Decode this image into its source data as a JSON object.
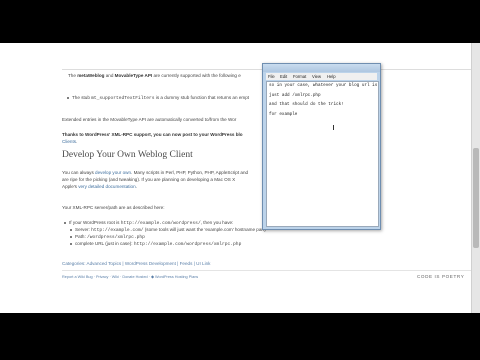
{
  "article": {
    "p1_a": "The ",
    "p1_api1": "metaWeblog",
    "p1_and": " and ",
    "p1_api2": "MovableType API",
    "p1_b": " are currently supported with the following e",
    "bullet1_a": "The stub ",
    "bullet1_code": "mt_supportedTextFilters",
    "bullet1_b": " is a dummy stub function that returns an empt",
    "p2": "Extended entries in the MovableType API are automatically converted to/from the Wor",
    "p3_bold": "Thanks to WordPress' XML-RPC support, you can now post to your WordPress blo",
    "p3_link": "Clients",
    "p3_tail": ".",
    "heading": "Develop Your Own Weblog Client",
    "p4_a": "You can always ",
    "p4_link": "develop your own",
    "p4_b": ". Many scripts in Perl, PHP, Python, PHP, AppleScript and",
    "p4_line2": "are ripe for the picking (and tweaking). If you are planning on developing a Mac OS X",
    "p4_line3_a": "Apple's ",
    "p4_line3_link": "very detailed documentation",
    "p4_line3_b": ".",
    "p5": "Your XML-RPC server/path are as described here:",
    "list_intro_a": "If your WordPress root is ",
    "list_intro_code": "http://example.com/wordpress/",
    "list_intro_b": ", then you have:",
    "sub1_a": "Server: ",
    "sub1_code": "http://example.com/",
    "sub1_b": " (some tools will just want the 'example.com' hostname part)",
    "sub2_a": "Path: ",
    "sub2_code": "/wordpress/xmlrpc.php",
    "sub3_a": "complete URL (just in case): ",
    "sub3_code": "http://example.com/wordpress/xmlrpc.php",
    "categories": "Categories: Advanced Topics | WordPress Development | Feeds | UI Link",
    "footer_links": "Report a Wiki Bug  ·  Privacy  ·  Wiki  ·  Donate Hosted  ·  ◆ WordPress Hosting Plans",
    "footer_brand": "CODE IS POETRY"
  },
  "notepad": {
    "menu": [
      "File",
      "Edit",
      "Format",
      "View",
      "Help"
    ],
    "lines": [
      "so in your case, whatever your blog url is",
      "just add /xmlrpc.php",
      "and that should do the trick!",
      "for example"
    ]
  }
}
